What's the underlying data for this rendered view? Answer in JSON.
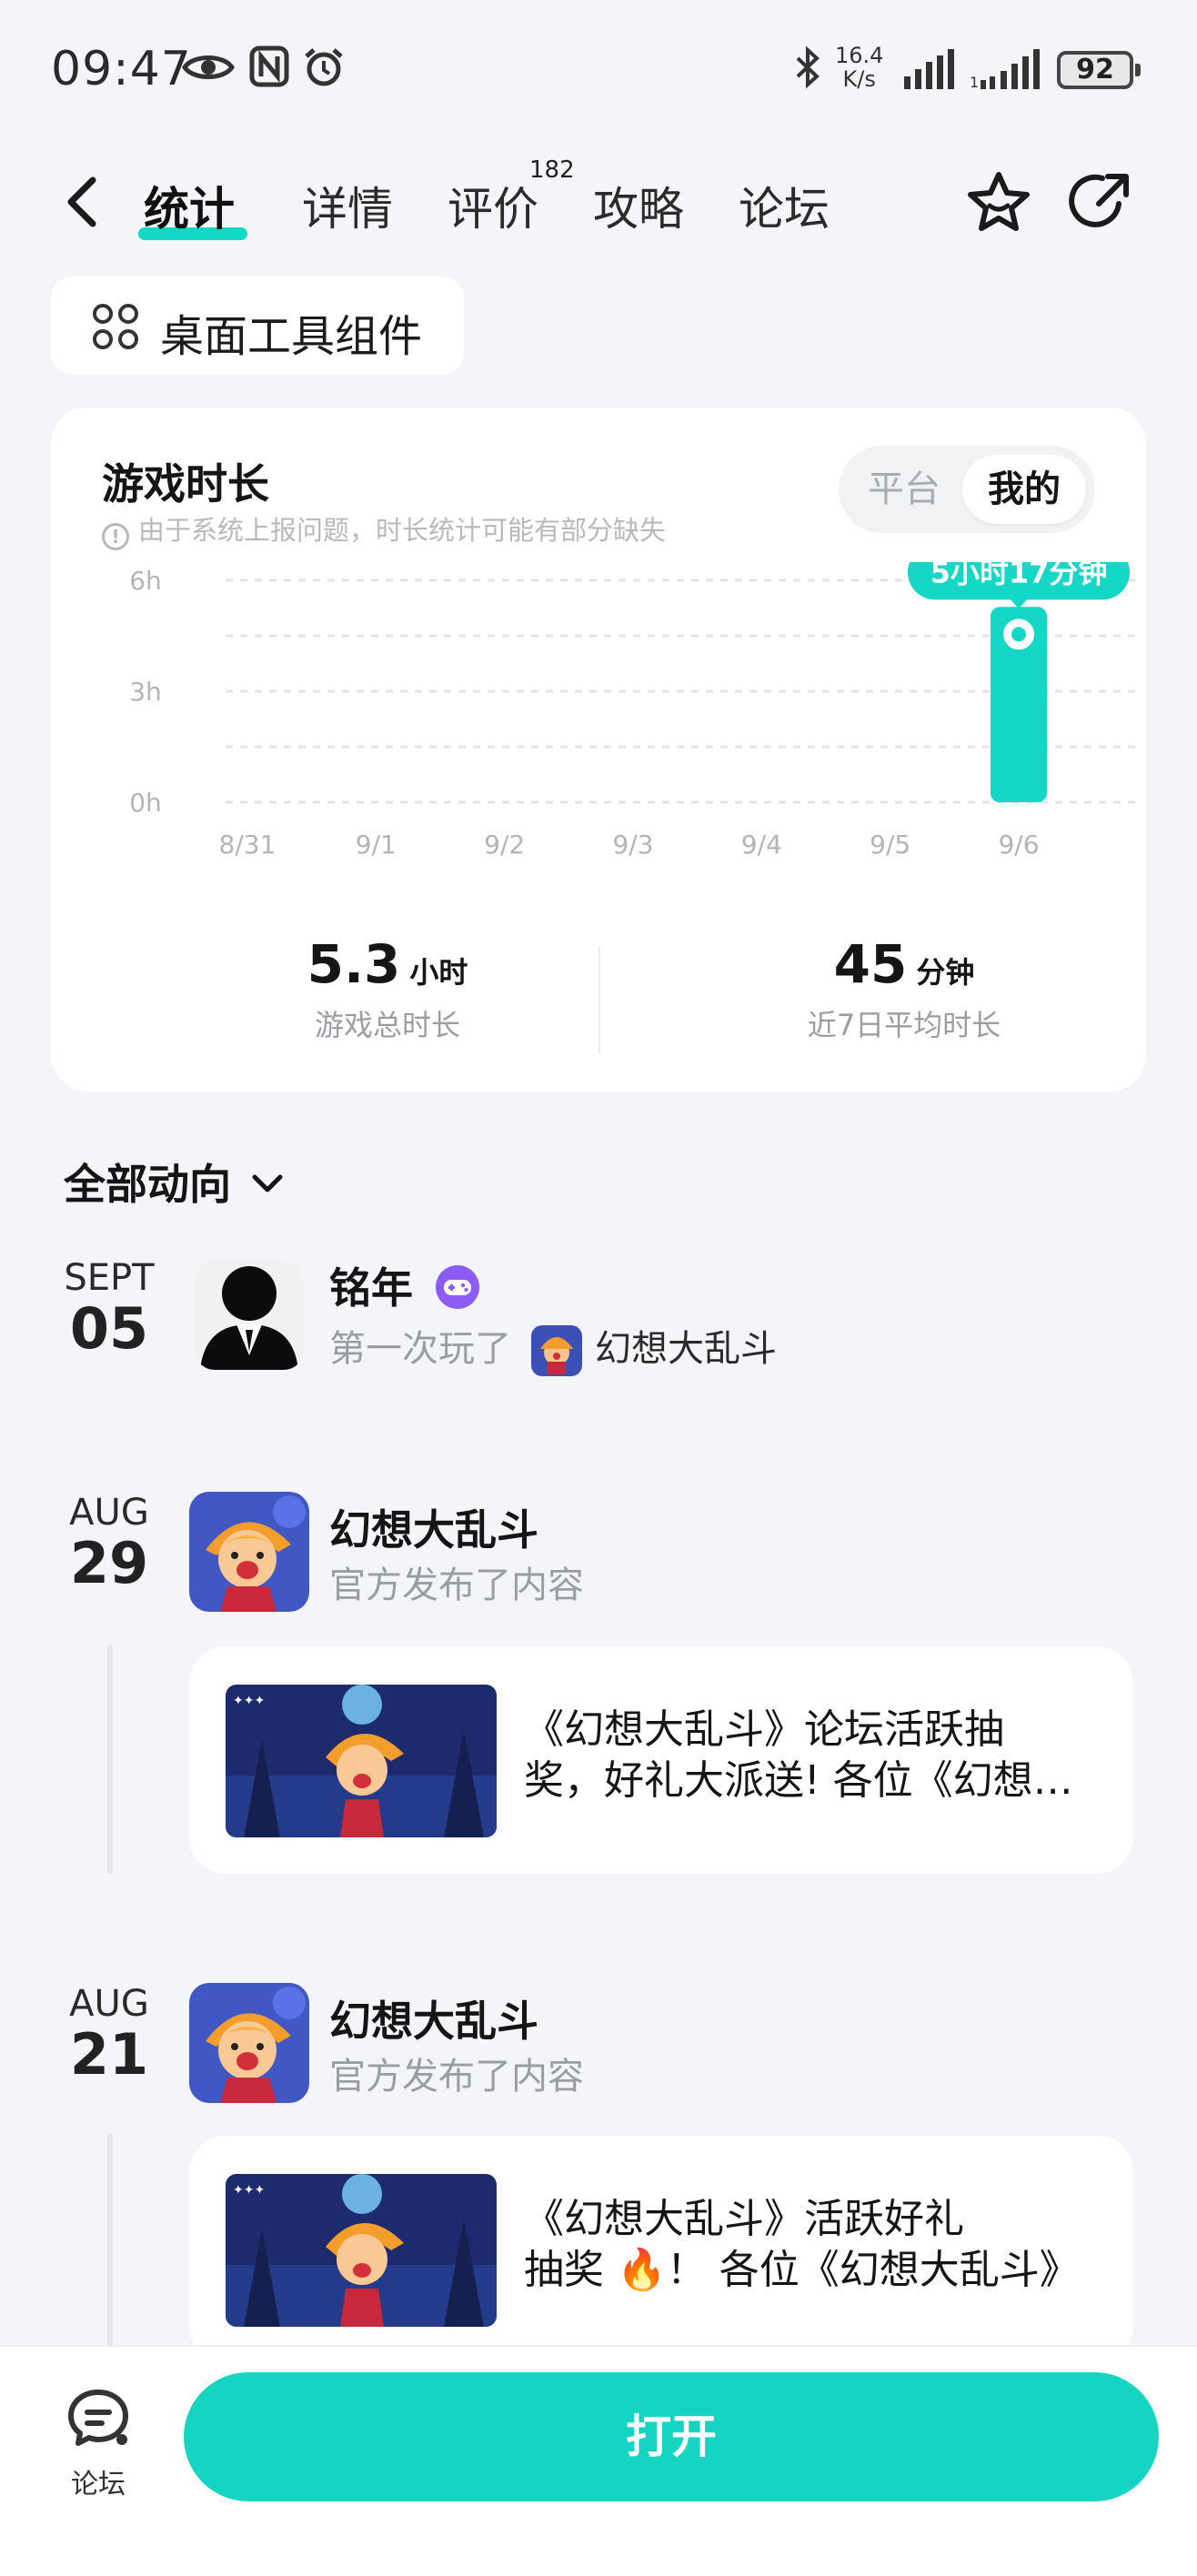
{
  "status_bar": {
    "time": "09:47",
    "net_speed_value": "16.4",
    "net_speed_unit": "K/s",
    "battery": "92",
    "icons": [
      "eye-icon",
      "nfc-icon",
      "alarm-icon",
      "bluetooth-icon",
      "signal-icon",
      "signal2-icon"
    ]
  },
  "nav": {
    "tabs": [
      {
        "label": "统计",
        "active": true
      },
      {
        "label": "详情",
        "active": false
      },
      {
        "label": "评价",
        "active": false
      },
      {
        "label": "攻略",
        "active": false
      },
      {
        "label": "论坛",
        "active": false
      }
    ],
    "review_count": "182",
    "accent": "#14d7c6"
  },
  "widget_chip": {
    "label": "桌面工具组件",
    "icon": "grid-icon"
  },
  "playtime": {
    "title": "游戏时长",
    "note": "由于系统上报问题，时长统计可能有部分缺失",
    "toggle": {
      "options": [
        "平台",
        "我的"
      ],
      "selected": "我的"
    },
    "total_value": "5.3",
    "total_unit": "小时",
    "total_label": "游戏总时长",
    "avg_value": "45",
    "avg_unit": "分钟",
    "avg_label": "近7日平均时长"
  },
  "chart_data": {
    "type": "bar",
    "categories": [
      "8/31",
      "9/1",
      "9/2",
      "9/3",
      "9/4",
      "9/5",
      "9/6"
    ],
    "values": [
      0,
      0,
      0,
      0,
      0,
      0,
      5.28
    ],
    "y_ticks": [
      "6h",
      "3h",
      "0h"
    ],
    "ylim": [
      0,
      6
    ],
    "highlight_label": "5小时17分钟",
    "bar_color": "#14d7c6",
    "grid": true
  },
  "feed": {
    "header": "全部动向",
    "items": [
      {
        "month": "SEPT",
        "day": "05",
        "name": "铭年",
        "action": "第一次玩了",
        "game": "幻想大乱斗"
      },
      {
        "month": "AUG",
        "day": "29",
        "name": "幻想大乱斗",
        "action": "官方发布了内容",
        "post_line1": "《幻想大乱斗》论坛活跃抽",
        "post_line2": "奖，好礼大派送! 各位《幻想大乱斗》"
      },
      {
        "month": "AUG",
        "day": "21",
        "name": "幻想大乱斗",
        "action": "官方发布了内容",
        "post_line1": "《幻想大乱斗》活跃好礼",
        "post_line2": "抽奖 🔥！ 各位《幻想大乱斗》"
      }
    ]
  },
  "bottom": {
    "forum_label": "论坛",
    "open_label": "打开"
  }
}
